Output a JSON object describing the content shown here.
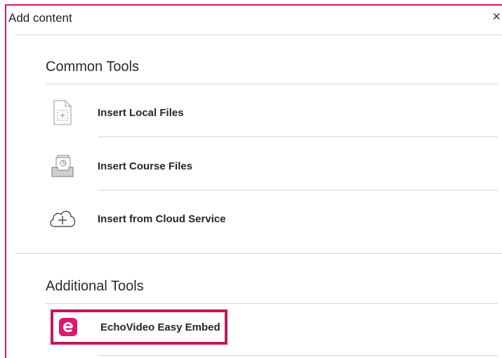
{
  "dialog": {
    "title": "Add content",
    "close_glyph": "×"
  },
  "common_tools": {
    "heading": "Common Tools",
    "items": [
      {
        "label": "Insert Local Files",
        "icon": "local-file-icon"
      },
      {
        "label": "Insert Course Files",
        "icon": "course-files-icon"
      },
      {
        "label": "Insert from Cloud Service",
        "icon": "cloud-add-icon"
      }
    ]
  },
  "additional_tools": {
    "heading": "Additional Tools",
    "items": [
      {
        "label": "EchoVideo Easy Embed",
        "icon": "echovideo-logo-icon"
      }
    ]
  },
  "colors": {
    "border_accent": "#d41a6b",
    "highlight": "#c2185b",
    "echo_brand": "#e0166f"
  }
}
